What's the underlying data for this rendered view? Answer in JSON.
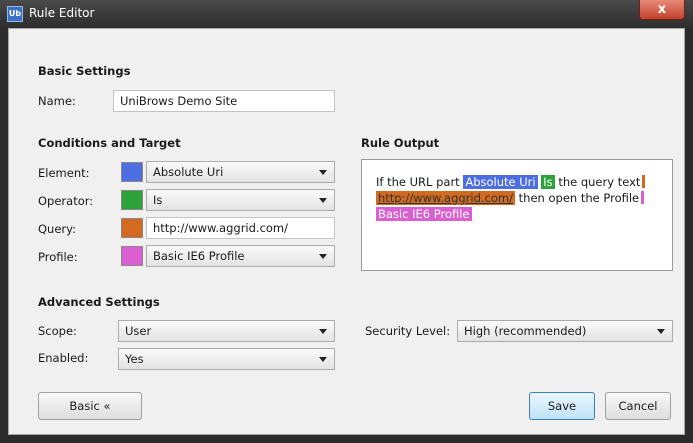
{
  "window": {
    "title": "Rule Editor",
    "app_icon_text": "Ub",
    "close_glyph": "x"
  },
  "basic": {
    "heading": "Basic Settings",
    "name_label": "Name:",
    "name_value": "UniBrows Demo Site"
  },
  "conditions": {
    "heading": "Conditions and Target",
    "element": {
      "label": "Element:",
      "value": "Absolute Uri",
      "color": "#4c6ee0"
    },
    "operator": {
      "label": "Operator:",
      "value": "Is",
      "color": "#2ea23a"
    },
    "query": {
      "label": "Query:",
      "value": "http://www.aggrid.com/",
      "color": "#d26a20"
    },
    "profile": {
      "label": "Profile:",
      "value": "Basic IE6 Profile",
      "color": "#da5fd2"
    }
  },
  "output": {
    "heading": "Rule Output",
    "t1": "If the URL part",
    "element": "Absolute Uri",
    "operator": "Is",
    "t2": "the query text",
    "query": "http://www.aggrid.com/",
    "t3": "then open the Profile",
    "profile": "Basic IE6 Profile"
  },
  "advanced": {
    "heading": "Advanced Settings",
    "scope_label": "Scope:",
    "scope_value": "User",
    "enabled_label": "Enabled:",
    "enabled_value": "Yes",
    "security_label": "Security Level:",
    "security_value": "High (recommended)"
  },
  "buttons": {
    "basic": "Basic  «",
    "save": "Save",
    "cancel": "Cancel"
  }
}
